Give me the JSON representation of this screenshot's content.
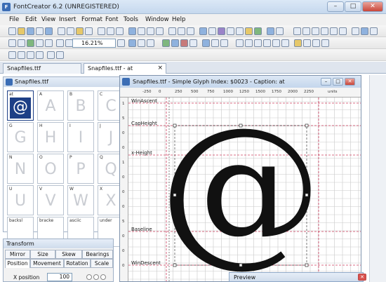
{
  "window": {
    "title": "FontCreator 6.2 (UNREGISTERED)",
    "min": "–",
    "max": "□",
    "close": "✕"
  },
  "menu": [
    "File",
    "Edit",
    "View",
    "Insert",
    "Format",
    "Font",
    "Tools",
    "Window",
    "Help"
  ],
  "toolbar": {
    "zoom_value": "16.21%"
  },
  "tabs": [
    {
      "label": "Snapfiles.ttf",
      "active": false
    },
    {
      "label": "Snapfiles.ttf - at",
      "active": true
    }
  ],
  "tab_close": "×",
  "font_window": {
    "title": "Snapfiles.ttf",
    "cells": [
      {
        "label": "at",
        "glyph": "@",
        "selected": true
      },
      {
        "label": "A",
        "glyph": "A"
      },
      {
        "label": "B",
        "glyph": "B"
      },
      {
        "label": "C",
        "glyph": "C"
      },
      {
        "label": "G",
        "glyph": "G"
      },
      {
        "label": "H",
        "glyph": "H"
      },
      {
        "label": "I",
        "glyph": "I"
      },
      {
        "label": "J",
        "glyph": "J"
      },
      {
        "label": "N",
        "glyph": "N"
      },
      {
        "label": "O",
        "glyph": "O"
      },
      {
        "label": "P",
        "glyph": "P"
      },
      {
        "label": "Q",
        "glyph": "Q"
      },
      {
        "label": "U",
        "glyph": "U"
      },
      {
        "label": "V",
        "glyph": "V"
      },
      {
        "label": "W",
        "glyph": "W"
      },
      {
        "label": "X",
        "glyph": "X"
      },
      {
        "label": "backsl",
        "glyph": ""
      },
      {
        "label": "bracke",
        "glyph": ""
      },
      {
        "label": "asciic",
        "glyph": ""
      },
      {
        "label": "under",
        "glyph": ""
      }
    ]
  },
  "transform": {
    "title": "Transform",
    "tabs_row1": [
      "Mirror",
      "Size",
      "Skew",
      "Bearings"
    ],
    "tabs_row2": [
      "Position",
      "Movement",
      "Rotation",
      "Scale"
    ],
    "active_tab": "Position",
    "x_position_label": "X position",
    "x_position_value": "100"
  },
  "glyph_window": {
    "title": "Snapfiles.ttf - Simple Glyph Index: $0023 - Caption: at",
    "ruler_h": [
      "-250",
      "0",
      "250",
      "500",
      "750",
      "1000",
      "1250",
      "1500",
      "1750",
      "2000",
      "2250"
    ],
    "ruler_unit": "units",
    "ruler_v": [
      "1",
      "5",
      "0",
      "0",
      "1",
      "0",
      "0",
      "0",
      "5",
      "0",
      "0",
      "0"
    ],
    "guides": {
      "win_ascent": "WinAscent",
      "cap_height": "CapHeight",
      "x_height": "x-Height",
      "baseline": "Baseline",
      "win_descent": "WinDescent"
    },
    "glyph_char": "@"
  },
  "preview": {
    "title": "Preview",
    "close": "✕"
  },
  "colors": {
    "accent": "#1d3f86",
    "guide_red": "#d04060",
    "grid": "#c9c9c9"
  }
}
